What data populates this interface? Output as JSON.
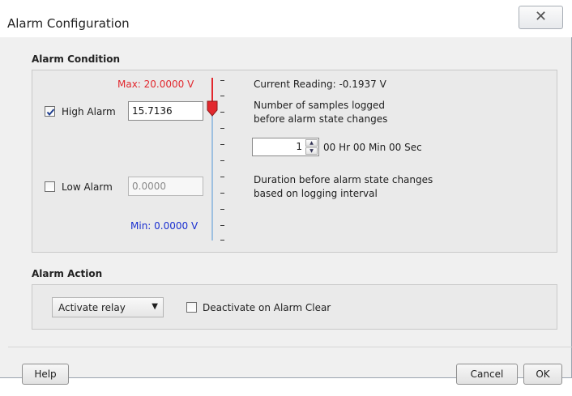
{
  "window": {
    "title": "Alarm Configuration",
    "close_glyph": "✕"
  },
  "alarm_condition": {
    "section_label": "Alarm Condition",
    "max_label": "Max: 20.0000 V",
    "min_label": "Min: 0.0000 V",
    "high_alarm": {
      "label": "High Alarm",
      "checked": true,
      "value": "15.7136"
    },
    "low_alarm": {
      "label": "Low Alarm",
      "checked": false,
      "value": "0.0000"
    },
    "current_reading": "Current Reading: -0.1937 V",
    "samples_text_line1": "Number of samples logged",
    "samples_text_line2": "before alarm state changes",
    "samples_value": "1",
    "samples_time": "00 Hr 00 Min 00 Sec",
    "duration_line1": "Duration before alarm state changes",
    "duration_line2": "based on logging interval",
    "high_alarm_level_fraction": 0.786
  },
  "alarm_action": {
    "section_label": "Alarm Action",
    "action_select": "Activate relay",
    "deactivate_label": "Deactivate on Alarm Clear",
    "deactivate_checked": false
  },
  "footer": {
    "help_label": "Help",
    "cancel_label": "Cancel",
    "ok_label": "OK"
  },
  "colors": {
    "max_text": "#e2282e",
    "min_text": "#1a2fd0",
    "scale": "#9ec0e0"
  }
}
